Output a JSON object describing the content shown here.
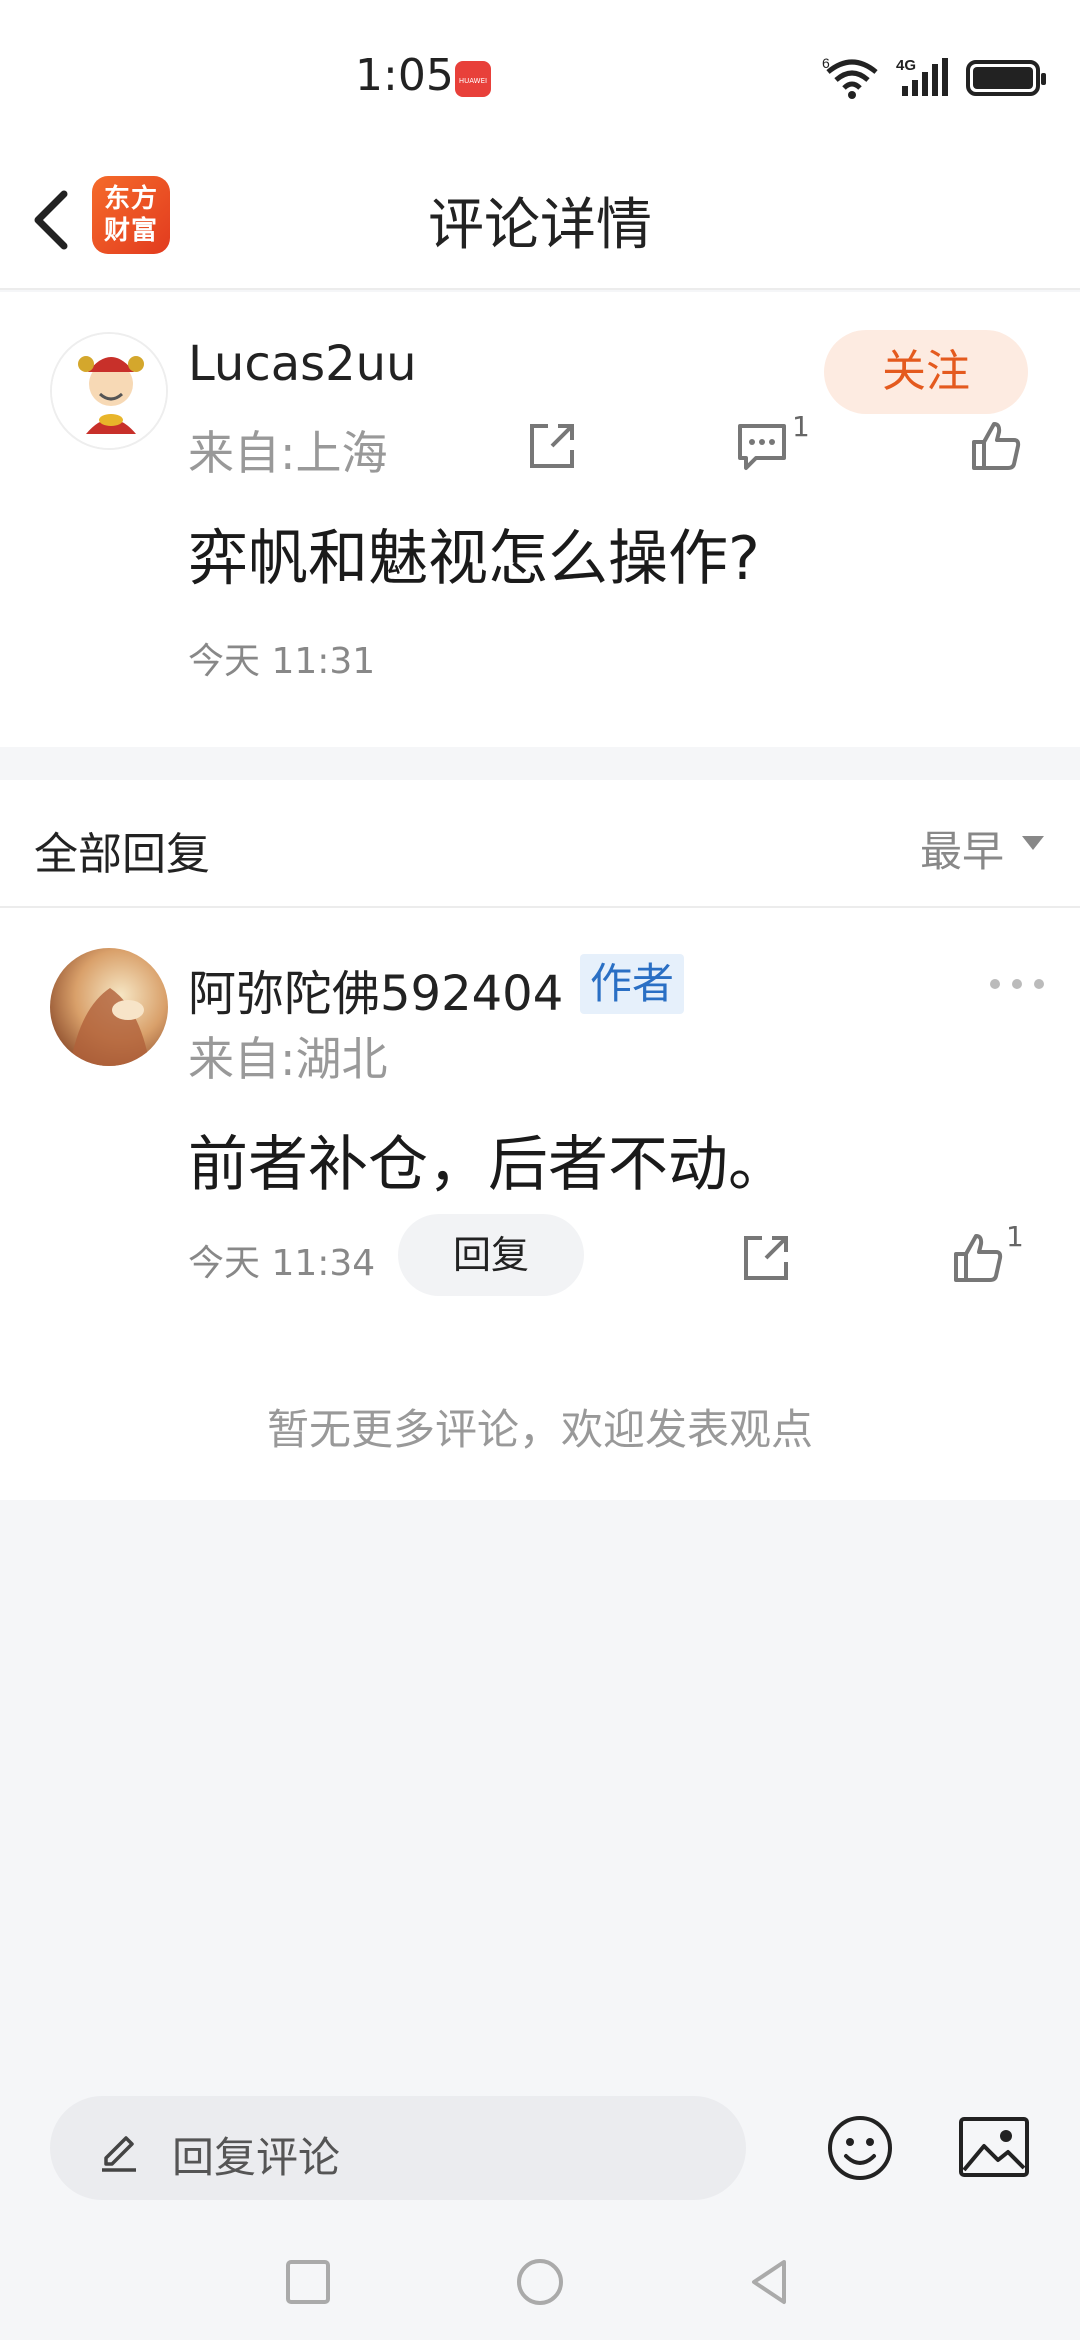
{
  "status_bar": {
    "time": "1:05",
    "app_badge": "HUAWEI",
    "wifi_label": "6",
    "network_label": "4G"
  },
  "header": {
    "logo_line1": "东方",
    "logo_line2": "财富",
    "title": "评论详情"
  },
  "post": {
    "username": "Lucas2uu",
    "location": "来自:上海",
    "follow_label": "关注",
    "content": "弈帆和魅视怎么操作?",
    "time": "今天 11:31",
    "comment_count": "1"
  },
  "replies": {
    "title": "全部回复",
    "sort_label": "最早",
    "items": [
      {
        "username": "阿弥陀佛592404",
        "badge": "作者",
        "location": "来自:湖北",
        "content": "前者补仓，后者不动。",
        "time": "今天 11:34",
        "reply_label": "回复",
        "like_count": "1"
      }
    ],
    "no_more_text": "暂无更多评论，欢迎发表观点"
  },
  "input_bar": {
    "placeholder": "回复评论"
  },
  "colors": {
    "accent_orange": "#e45a1e",
    "follow_bg": "#fdebe1",
    "author_badge_bg": "#e6f0fb",
    "author_badge_text": "#2a6fc4"
  }
}
